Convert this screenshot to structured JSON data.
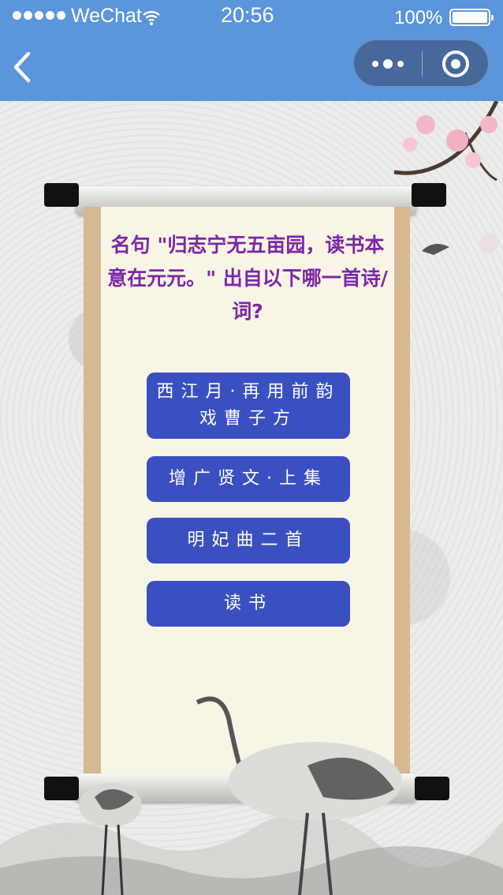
{
  "status_bar": {
    "carrier": "WeChat",
    "time": "20:56",
    "battery": "100%"
  },
  "nav": {
    "back_icon": "chevron-left-icon",
    "more_icon": "more-dots-icon",
    "close_icon": "target-close-icon"
  },
  "quiz": {
    "question": "名句 \"归志宁无五亩园，读书本意在元元。\" 出自以下哪一首诗/词?",
    "options": [
      {
        "line1": "西江月·再用前韵",
        "line2": "戏曹子方"
      },
      {
        "line1": "增广贤文·上集",
        "line2": ""
      },
      {
        "line1": "明妃曲二首",
        "line2": ""
      },
      {
        "line1": "读书",
        "line2": ""
      }
    ]
  },
  "colors": {
    "header": "#5b95db",
    "question_text": "#7d27a7",
    "option_bg": "#3b50c0"
  }
}
